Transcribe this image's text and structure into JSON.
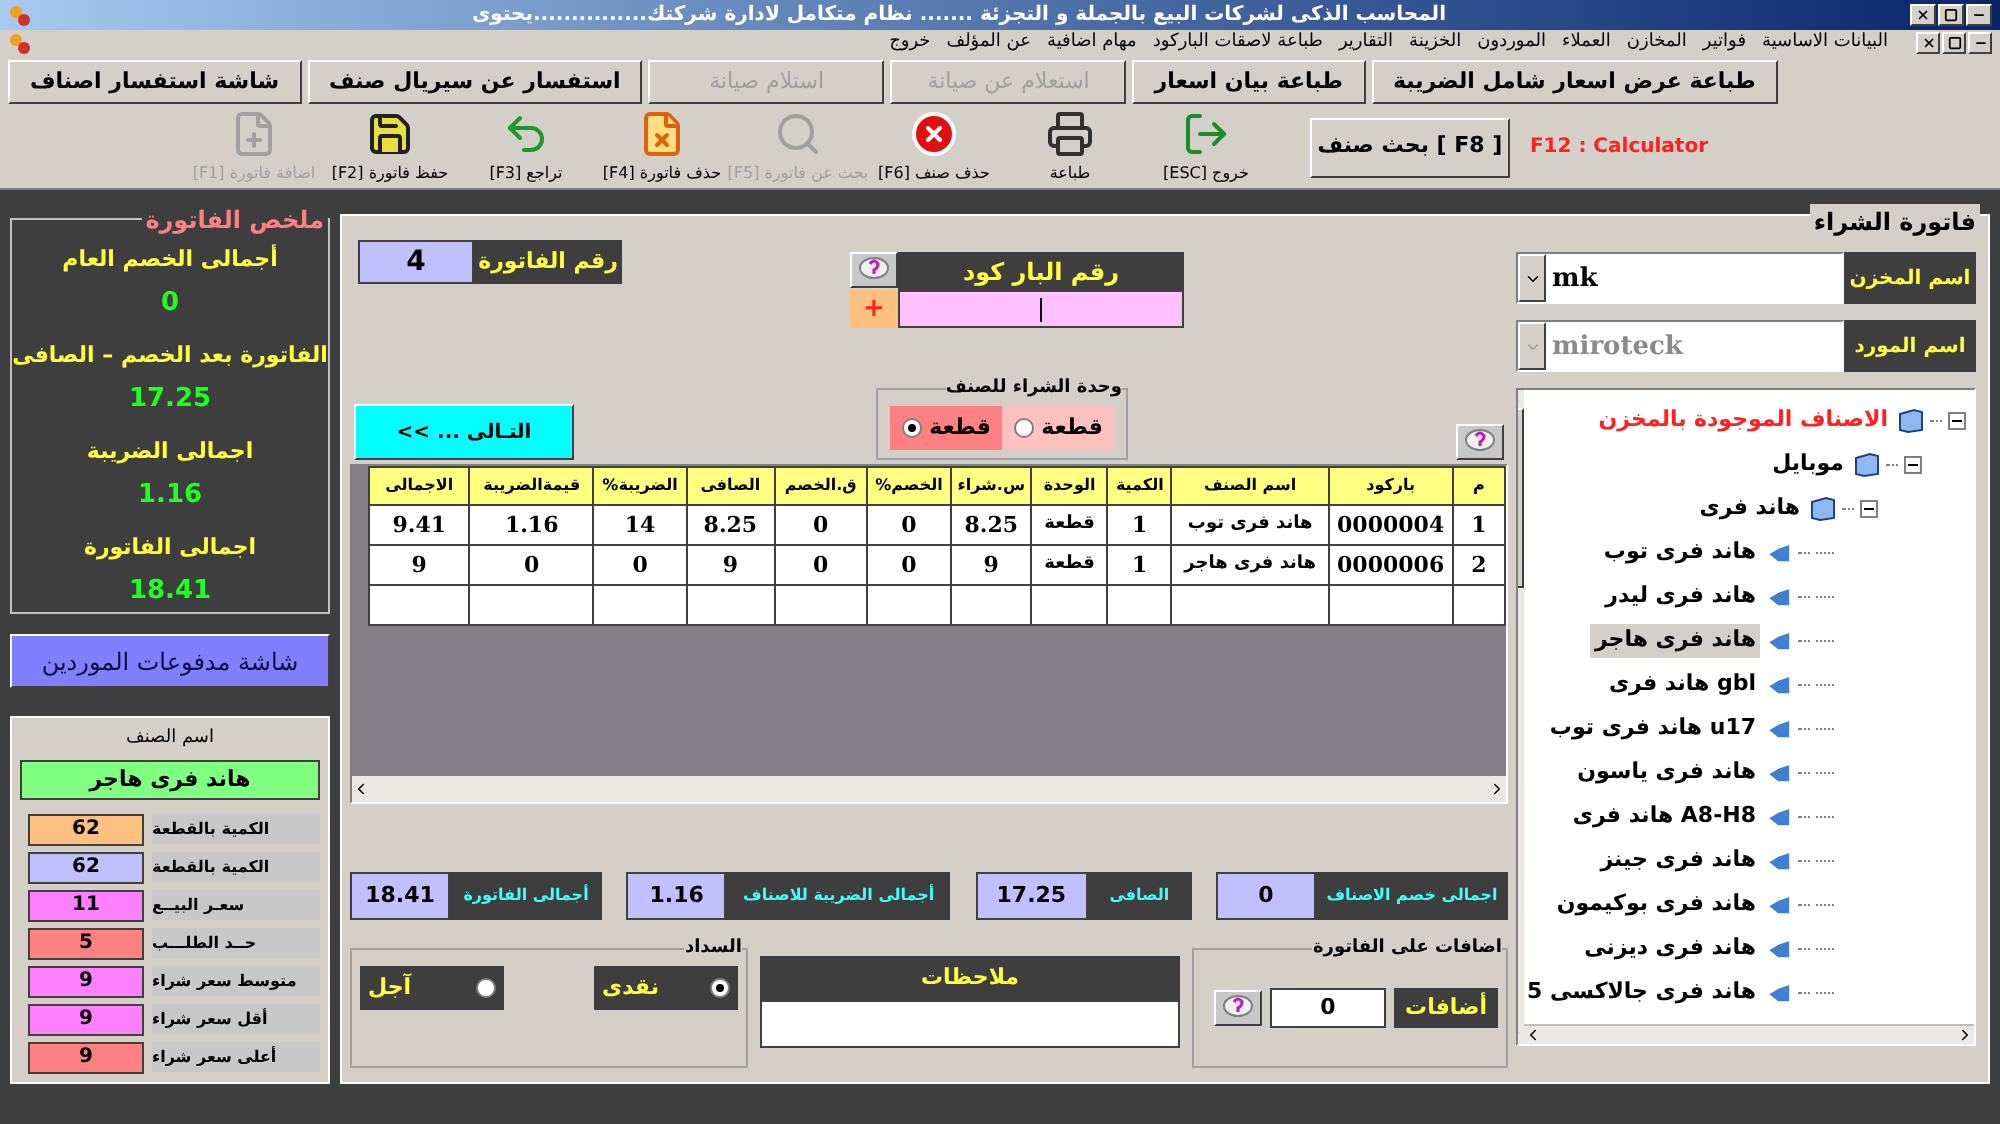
{
  "window": {
    "title": "المحاسب الذكى لشركات البيع بالجملة و التجزئة ....... نظام متكامل لادارة شركتك...............يحتوى"
  },
  "menu": [
    "البيانات الاساسية",
    "فواتير",
    "المخازن",
    "العملاء",
    "الموردون",
    "الخزينة",
    "التقارير",
    "طباعة لاصقات الباركود",
    "مهام اضافية",
    "عن المؤلف",
    "خروج"
  ],
  "top_buttons": [
    {
      "label": "طباعة عرض اسعار شامل الضريبة",
      "disabled": false
    },
    {
      "label": "طباعة بيان اسعار",
      "disabled": false
    },
    {
      "label": "استعلام عن صيانة",
      "disabled": true
    },
    {
      "label": "استلام صيانة",
      "disabled": true
    },
    {
      "label": "استفسار عن سيريال صنف",
      "disabled": false
    },
    {
      "label": "شاشة استفسار اصناف",
      "disabled": false
    }
  ],
  "calculator_hint": "F12 : Calculator",
  "search_button": "[ F8 ] بحث صنف",
  "toolbar": [
    {
      "kind": "exit",
      "label": "خروج [ESC]",
      "disabled": false
    },
    {
      "kind": "print",
      "label": "طباعة",
      "disabled": false
    },
    {
      "kind": "delete-item",
      "label": "حذف صنف [F6]",
      "disabled": false
    },
    {
      "kind": "search",
      "label": "بحث عن فاتورة [F5]",
      "disabled": true
    },
    {
      "kind": "delete-invoice",
      "label": "حذف فاتورة [F4]",
      "disabled": false
    },
    {
      "kind": "undo",
      "label": "تراجع [F3]",
      "disabled": false
    },
    {
      "kind": "save",
      "label": "حفظ فاتورة [F2]",
      "disabled": false
    },
    {
      "kind": "add",
      "label": "اضافة فاتورة [F1]",
      "disabled": true
    }
  ],
  "summary": {
    "title": "ملخص الفاتورة",
    "items": [
      {
        "label": "أجمالى الخصم العام",
        "value": "0"
      },
      {
        "label": "الفاتورة بعد الخصم – الصافى",
        "value": "17.25"
      },
      {
        "label": "اجمالى الضريبة",
        "value": "1.16"
      },
      {
        "label": "اجمالى الفاتورة",
        "value": "18.41"
      }
    ]
  },
  "supplier_payments_button": "شاشة مدفوعات الموردين",
  "item_info": {
    "name_label": "اسم الصنف",
    "name": "هاند فرى هاجر",
    "fields": [
      {
        "label": "الكمية بالقطعة",
        "value": "62",
        "color": "#ffc080"
      },
      {
        "label": "الكمية بالقطعة",
        "value": "62",
        "color": "#c0c0ff"
      },
      {
        "label": "سعـر البيــع",
        "value": "11",
        "color": "#ff80ff"
      },
      {
        "label": "حــد الطلـــب",
        "value": "5",
        "color": "#ff8080"
      },
      {
        "label": "متوسط سعر شراء",
        "value": "9",
        "color": "#ff80ff"
      },
      {
        "label": "أقل سعر شراء",
        "value": "9",
        "color": "#ff80ff"
      },
      {
        "label": "أعلى سعر شراء",
        "value": "9",
        "color": "#ff8080"
      }
    ]
  },
  "invoice": {
    "title": "فاتورة الشراء",
    "number_label": "رقم الفاتورة",
    "number": "4",
    "barcode_label": "رقم البار كود",
    "barcode_add": "+",
    "next_button": "التـالى ... >>",
    "unit_group": {
      "title": "وحدة الشراء للصنف",
      "options": [
        {
          "label": "قطعة",
          "selected": false
        },
        {
          "label": "قطعة",
          "selected": true
        }
      ]
    },
    "table": {
      "columns": [
        "م",
        "باركود",
        "اسم الصنف",
        "الكمية",
        "الوحدة",
        "س.شراء",
        "الخصم%",
        "ق.الخصم",
        "الصافى",
        "الضريبة%",
        "قيمةالضريبة",
        "الاجمالى"
      ],
      "rows": [
        [
          "1",
          "0000004",
          "هاند فرى توب",
          "1",
          "قطعة",
          "8.25",
          "0",
          "0",
          "8.25",
          "14",
          "1.16",
          "9.41"
        ],
        [
          "2",
          "0000006",
          "هاند فرى هاجر",
          "1",
          "قطعة",
          "9",
          "0",
          "0",
          "9",
          "0",
          "0",
          "9"
        ]
      ]
    },
    "totals": [
      {
        "label": "اجمالى خصم الاصناف",
        "value": "0"
      },
      {
        "label": "الصافى",
        "value": "17.25"
      },
      {
        "label": "أجمالى الضريبة  للاصناف",
        "value": "1.16"
      },
      {
        "label": "أجمالى الفاتورة",
        "value": "18.41"
      }
    ],
    "additions": {
      "title": "اضافات على الفاتورة",
      "label": "أضافات",
      "value": "0"
    },
    "notes_label": "ملاحظات",
    "payment": {
      "title": "السداد",
      "options": [
        {
          "label": "نقدى",
          "selected": true
        },
        {
          "label": "آجل",
          "selected": false
        }
      ]
    },
    "store": {
      "label": "اسم المخزن",
      "value": "mk",
      "disabled": false
    },
    "supplier": {
      "label": "اسم المورد",
      "value": "miroteck",
      "disabled": true
    },
    "tree": [
      {
        "label": "الاصناف الموجودة بالمخزن",
        "kind": "category",
        "expanded": true,
        "children": [
          {
            "label": "موبايل",
            "kind": "category",
            "expanded": true,
            "children": [
              {
                "label": "هاند فرى",
                "kind": "category",
                "expanded": true,
                "children": [
                  {
                    "label": "هاند فرى توب",
                    "kind": "item",
                    "selected": false
                  },
                  {
                    "label": "هاند فرى  ليدر",
                    "kind": "item",
                    "selected": false
                  },
                  {
                    "label": "هاند فرى هاجر",
                    "kind": "item",
                    "selected": true
                  },
                  {
                    "label": "gbl هاند فرى",
                    "kind": "item",
                    "selected": false
                  },
                  {
                    "label": "u17 هاند فرى توب",
                    "kind": "item",
                    "selected": false
                  },
                  {
                    "label": "هاند فرى ياسون",
                    "kind": "item",
                    "selected": false
                  },
                  {
                    "label": "A8-H8 هاند فرى",
                    "kind": "item",
                    "selected": false
                  },
                  {
                    "label": "هاند فرى  جينز",
                    "kind": "item",
                    "selected": false
                  },
                  {
                    "label": "هاند فرى  بوكيمون",
                    "kind": "item",
                    "selected": false
                  },
                  {
                    "label": "هاند فرى ديزنى",
                    "kind": "item",
                    "selected": false
                  },
                  {
                    "label": "هاند فرى جالاكسى 5",
                    "kind": "item",
                    "selected": false
                  }
                ]
              }
            ]
          }
        ]
      }
    ]
  }
}
